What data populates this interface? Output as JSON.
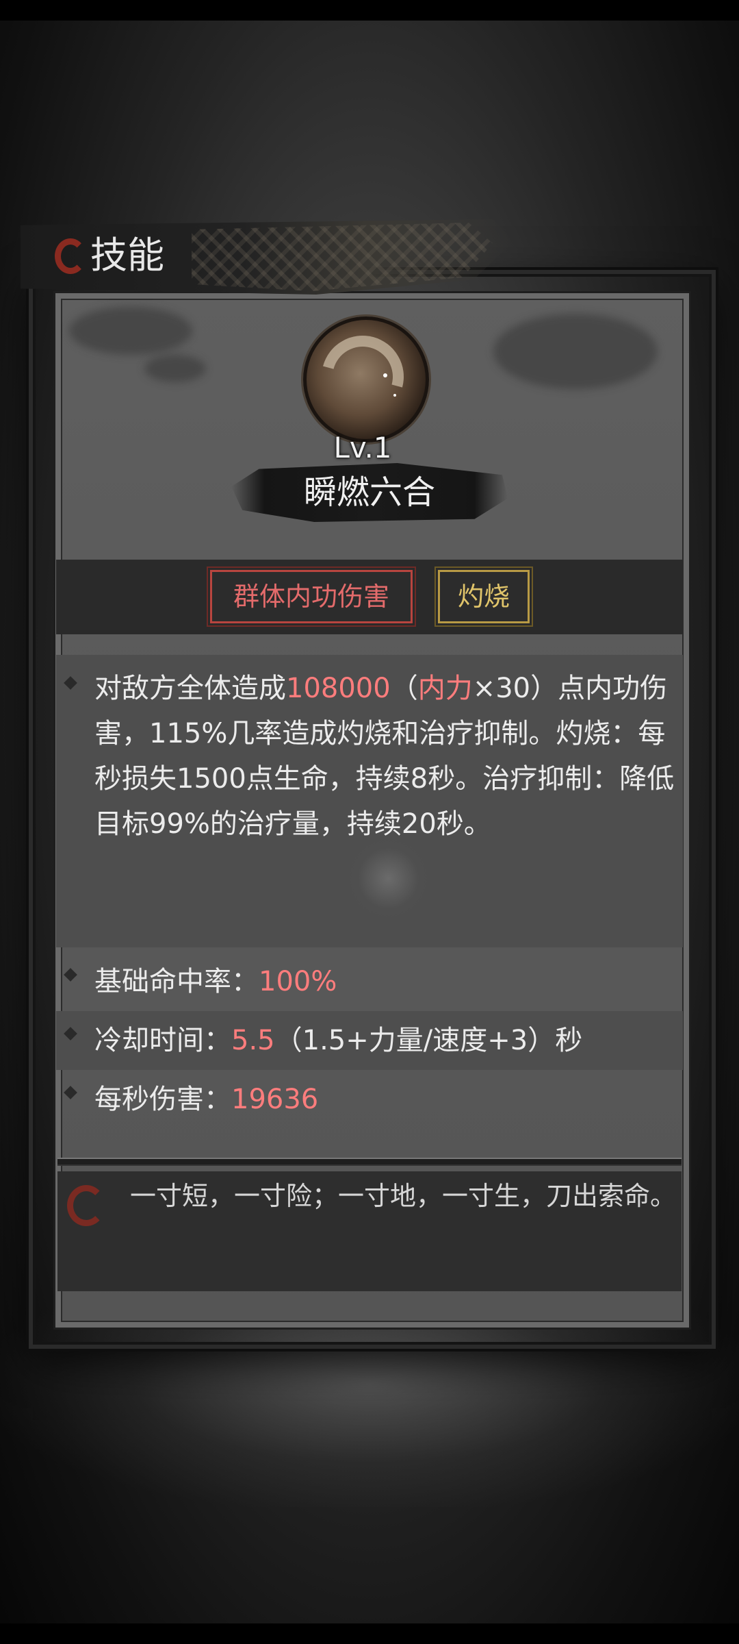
{
  "header": {
    "title": "技能"
  },
  "skill": {
    "level": "Lv.1",
    "name": "瞬燃六合",
    "tags": [
      "群体内功伤害",
      "灼烧"
    ]
  },
  "description": {
    "part1": "对敌方全体造成",
    "damage_value": "108000",
    "part2": "（",
    "stat_name": "内力",
    "part3": "×30）点内功伤害，115%几率造成灼烧和治疗抑制。灼烧：每秒损失1500点生命，持续8秒。治疗抑制：降低目标99%的治疗量，持续20秒。"
  },
  "stats": {
    "hit_rate_label": "基础命中率：",
    "hit_rate_value": "100%",
    "cooldown_label": "冷却时间：",
    "cooldown_value": "5.5",
    "cooldown_formula": "（1.5+力量/速度+3）秒",
    "dps_label": "每秒伤害：",
    "dps_value": "19636"
  },
  "quote": "一寸短，一寸险；一寸地，一寸生，刀出索命。",
  "colors": {
    "highlight_red": "#ff7d7d",
    "tag_red": "#e46b6b",
    "tag_yellow": "#e0c46a",
    "accent_icon": "#8a2a20"
  }
}
